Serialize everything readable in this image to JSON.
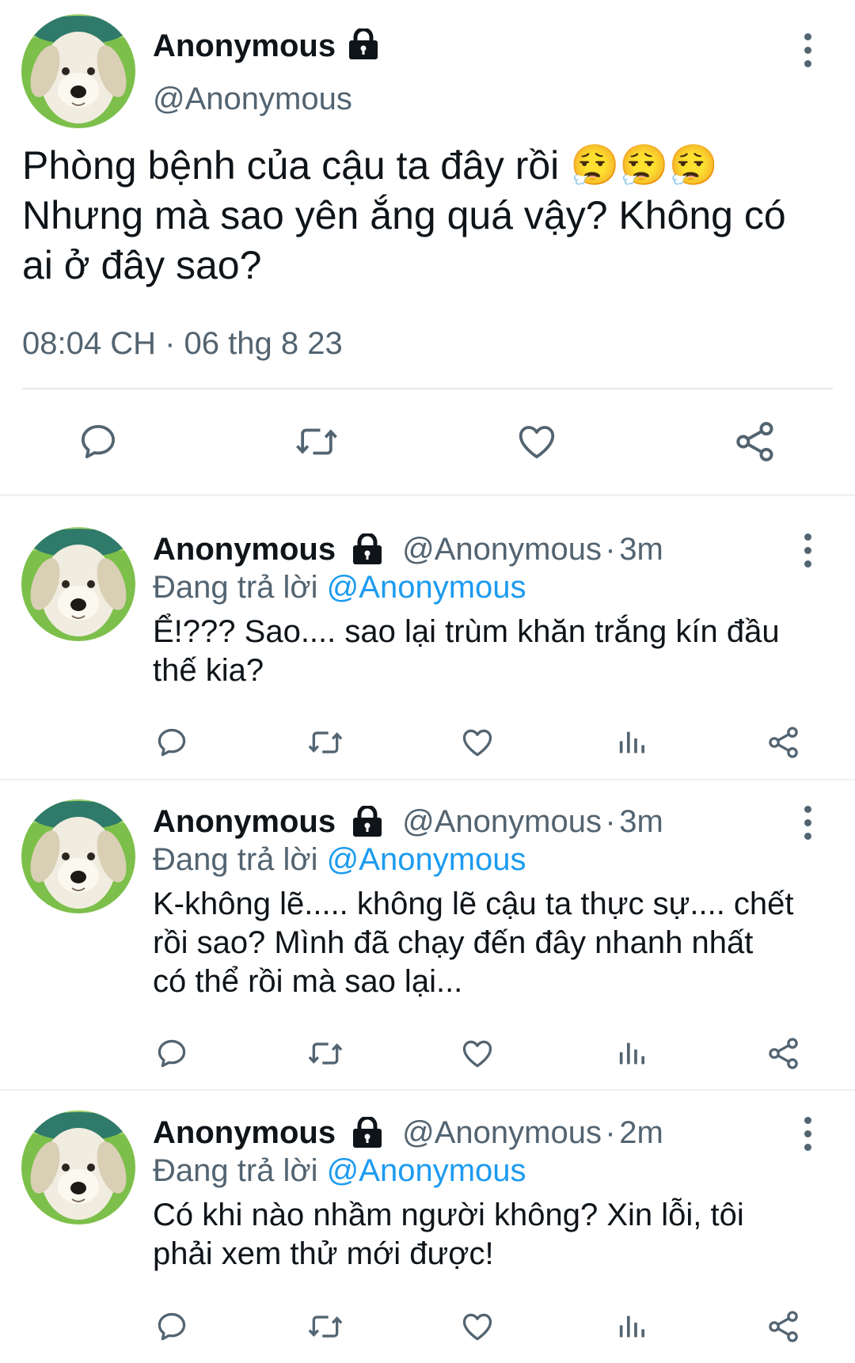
{
  "colors": {
    "text_primary": "#0f1419",
    "text_secondary": "#536471",
    "mention": "#1d9bf0",
    "divider": "#eff1f3"
  },
  "main_tweet": {
    "author_name": "Anonymous",
    "handle": "@Anonymous",
    "text_lines": [
      "Phòng bệnh của cậu ta đây rồi 😮‍💨😮‍💨😮‍💨",
      "Nhưng mà sao yên ắng quá vậy? Không có",
      "ai ở đây sao?"
    ],
    "timestamp": "08:04 CH · 06 thg 8 23",
    "actions": [
      "reply-icon",
      "retweet-icon",
      "like-icon",
      "share-icon"
    ]
  },
  "replies": [
    {
      "author_name": "Anonymous",
      "handle": "@Anonymous",
      "separator": "·",
      "age": "3m",
      "replying_prefix": "Đang trả lời",
      "replying_to": "@Anonymous",
      "text_lines": [
        "Ể!??? Sao.... sao lại trùm khăn trắng kín đầu",
        "thế kia?"
      ]
    },
    {
      "author_name": "Anonymous",
      "handle": "@Anonymous",
      "separator": "·",
      "age": "3m",
      "replying_prefix": "Đang trả lời",
      "replying_to": "@Anonymous",
      "text_lines": [
        "K-không lẽ..... không lẽ cậu ta thực sự.... chết",
        "rồi sao? Mình đã chạy đến đây nhanh nhất",
        "có thể rồi mà sao lại..."
      ]
    },
    {
      "author_name": "Anonymous",
      "handle": "@Anonymous",
      "separator": "·",
      "age": "2m",
      "replying_prefix": "Đang trả lời",
      "replying_to": "@Anonymous",
      "text_lines": [
        "Có khi nào nhầm người không? Xin lỗi, tôi",
        "phải xem thử mới được!"
      ]
    }
  ],
  "reply_actions": [
    "reply-icon",
    "retweet-icon",
    "like-icon",
    "views-icon",
    "share-icon"
  ]
}
